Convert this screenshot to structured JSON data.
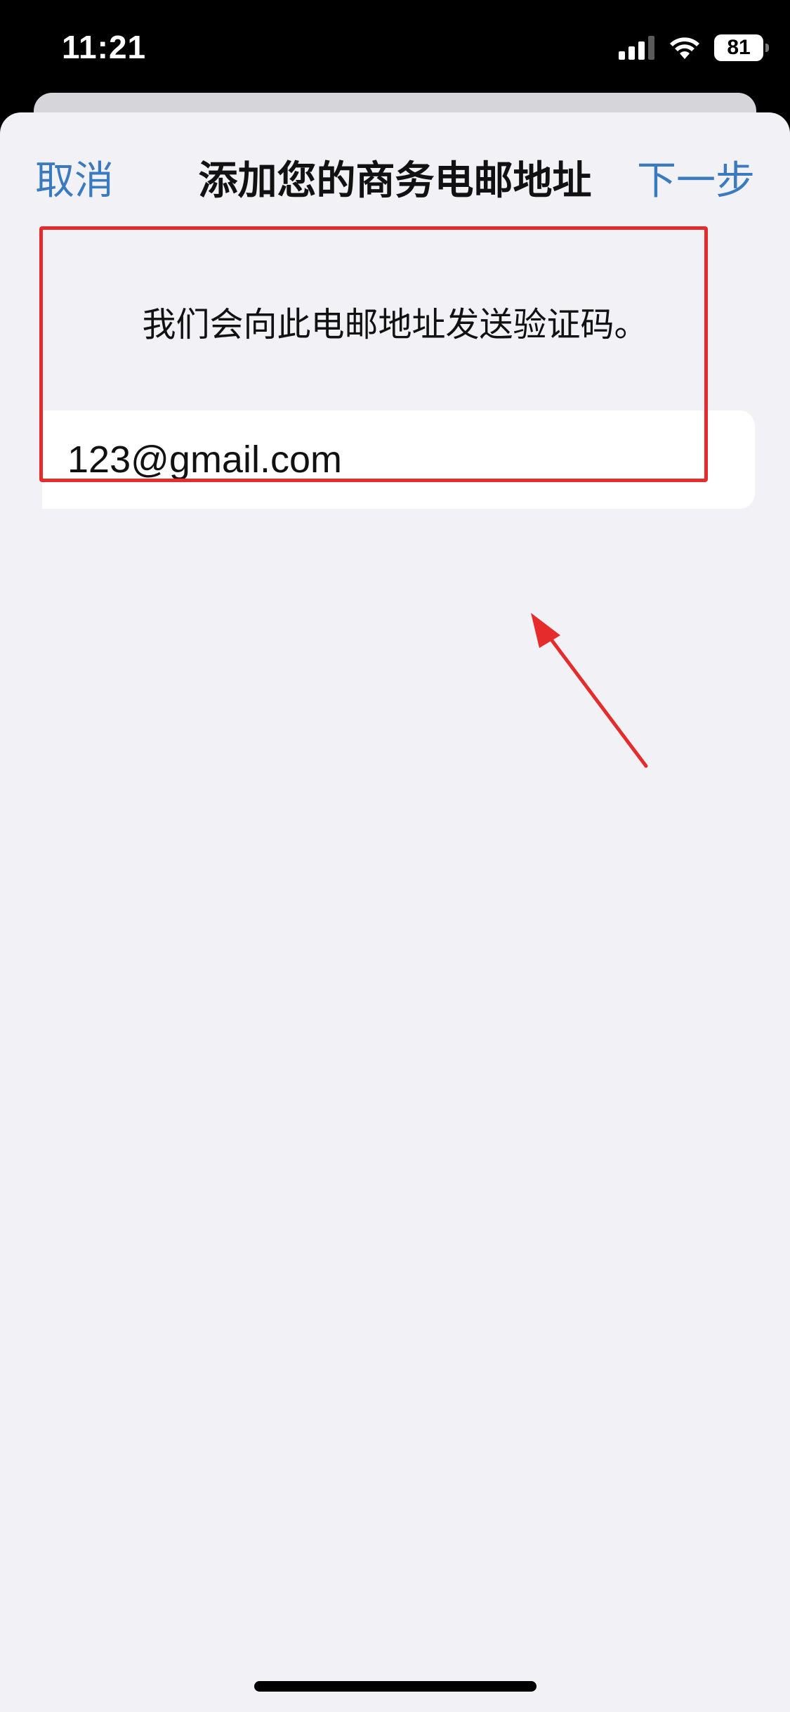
{
  "status_bar": {
    "time": "11:21",
    "battery": "81"
  },
  "nav": {
    "cancel_label": "取消",
    "title": "添加您的商务电邮地址",
    "next_label": "下一步"
  },
  "form": {
    "description": "我们会向此电邮地址发送验证码。",
    "email_value": "123@gmail.com"
  },
  "colors": {
    "accent": "#3a7bbf",
    "annotation": "#e52b2b",
    "sheet_background": "#f1f1f6"
  },
  "icons": [
    "cellular-signal-icon",
    "wifi-icon",
    "battery-icon",
    "annotation-arrow-icon"
  ]
}
